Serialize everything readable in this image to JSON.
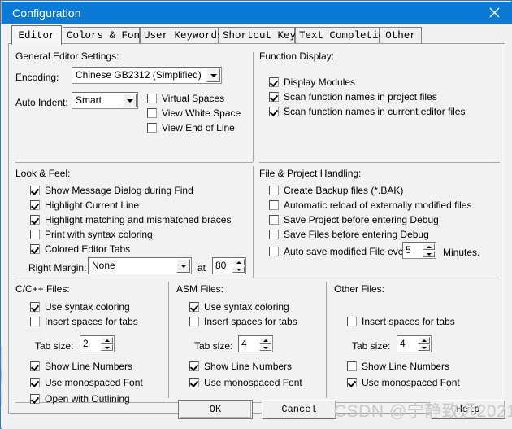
{
  "window": {
    "title": "Configuration",
    "close_icon": "close-icon",
    "titlebar_color": "#0b7ad4",
    "dialog_background": "#f0f0f0"
  },
  "tabs": [
    {
      "label": "Editor",
      "selected": true
    },
    {
      "label": "Colors & Fonts",
      "selected": false
    },
    {
      "label": "User Keywords",
      "selected": false
    },
    {
      "label": "Shortcut Keys",
      "selected": false
    },
    {
      "label": "Text Completion",
      "selected": false
    },
    {
      "label": "Other",
      "selected": false
    }
  ],
  "general_editor_settings": {
    "title": "General Editor Settings:",
    "encoding_label": "Encoding:",
    "encoding_value": "Chinese GB2312 (Simplified)",
    "auto_indent_label": "Auto Indent:",
    "auto_indent_value": "Smart",
    "checkboxes": [
      {
        "label": "Virtual Spaces",
        "checked": false
      },
      {
        "label": "View White Space",
        "checked": false
      },
      {
        "label": "View End of Line",
        "checked": false
      }
    ]
  },
  "function_display": {
    "title": "Function Display:",
    "checkboxes": [
      {
        "label": "Display Modules",
        "checked": true
      },
      {
        "label": "Scan function names in project files",
        "checked": true
      },
      {
        "label": "Scan function names in current editor files",
        "checked": true
      }
    ]
  },
  "look_and_feel": {
    "title": "Look & Feel:",
    "checkboxes": [
      {
        "label": "Show Message Dialog during Find",
        "checked": true
      },
      {
        "label": "Highlight Current Line",
        "checked": true
      },
      {
        "label": "Highlight matching and mismatched braces",
        "checked": true
      },
      {
        "label": "Print with syntax coloring",
        "checked": false
      },
      {
        "label": "Colored Editor Tabs",
        "checked": true
      }
    ],
    "right_margin_label": "Right Margin:",
    "right_margin_value": "None",
    "at_label": "at",
    "at_value": "80"
  },
  "file_project_handling": {
    "title": "File & Project Handling:",
    "checkboxes": [
      {
        "label": "Create Backup files (*.BAK)",
        "checked": false
      },
      {
        "label": "Automatic reload of externally modified files",
        "checked": false
      },
      {
        "label": "Save Project before entering Debug",
        "checked": false
      },
      {
        "label": "Save Files before entering Debug",
        "checked": false
      },
      {
        "label": "Auto save modified File every",
        "checked": false
      }
    ],
    "autosave_minutes": "5",
    "minutes_label": "Minutes."
  },
  "c_cpp_files": {
    "title": "C/C++ Files:",
    "checkboxes_top": [
      {
        "label": "Use syntax coloring",
        "checked": true
      },
      {
        "label": "Insert spaces for tabs",
        "checked": false
      }
    ],
    "tab_size_label": "Tab size:",
    "tab_size_value": "2",
    "checkboxes_bottom": [
      {
        "label": "Show Line Numbers",
        "checked": true
      },
      {
        "label": "Use monospaced Font",
        "checked": true
      },
      {
        "label": "Open with Outlining",
        "checked": true
      }
    ]
  },
  "asm_files": {
    "title": "ASM Files:",
    "checkboxes_top": [
      {
        "label": "Use syntax coloring",
        "checked": true
      },
      {
        "label": "Insert spaces for tabs",
        "checked": false
      }
    ],
    "tab_size_label": "Tab size:",
    "tab_size_value": "4",
    "checkboxes_bottom": [
      {
        "label": "Show Line Numbers",
        "checked": true
      },
      {
        "label": "Use monospaced Font",
        "checked": true
      }
    ]
  },
  "other_files": {
    "title": "Other Files:",
    "checkboxes_top": [
      {
        "label": "Insert spaces for tabs",
        "checked": false
      }
    ],
    "tab_size_label": "Tab size:",
    "tab_size_value": "4",
    "checkboxes_bottom": [
      {
        "label": "Show Line Numbers",
        "checked": false
      },
      {
        "label": "Use monospaced Font",
        "checked": true
      }
    ]
  },
  "footer": {
    "ok_label": "OK",
    "cancel_label": "Cancel",
    "help_label": "Help"
  },
  "watermark": {
    "text": "CSDN @宁静致远2021"
  }
}
